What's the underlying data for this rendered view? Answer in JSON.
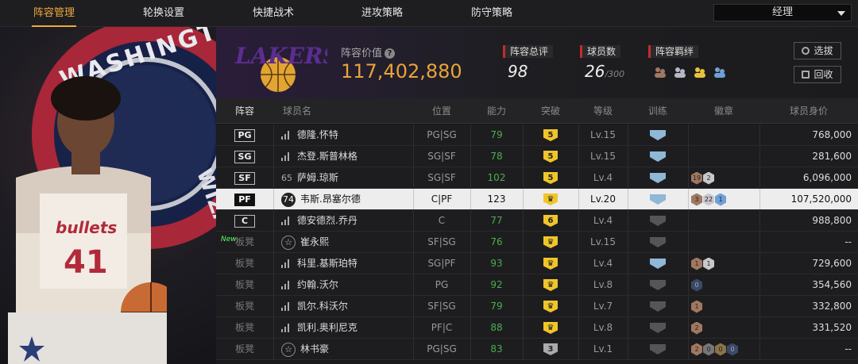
{
  "nav": {
    "tabs": [
      "阵容管理",
      "轮换设置",
      "快捷战术",
      "进攻策略",
      "防守策略"
    ],
    "active": 0,
    "manager_select": "经理"
  },
  "header": {
    "value_label": "阵容价值",
    "value": "117,402,880",
    "overall_label": "阵容总评",
    "overall": "98",
    "count_label": "球员数",
    "count": "26",
    "count_max": "/300",
    "bond_label": "阵容羁绊",
    "buttons": [
      "选拔",
      "回收"
    ]
  },
  "table": {
    "headers": [
      "阵容",
      "球员名",
      "位置",
      "能力",
      "突破",
      "等级",
      "训练",
      "徽章",
      "球员身价"
    ],
    "rows": [
      {
        "slot": "PG",
        "num": "",
        "name": "德隆.怀特",
        "position": "PG|SG",
        "ability": "79",
        "breakthrough": "5",
        "level": "Lv.15",
        "training": "blue",
        "badges": [],
        "value": "768,000",
        "green": true
      },
      {
        "slot": "SG",
        "num": "",
        "name": "杰登.斯普林格",
        "position": "SG|SF",
        "ability": "78",
        "breakthrough": "5",
        "level": "Lv.15",
        "training": "blue",
        "badges": [],
        "value": "281,600",
        "green": true
      },
      {
        "slot": "SF",
        "num": "65",
        "name": "萨姆.琼斯",
        "position": "SG|SF",
        "ability": "102",
        "breakthrough": "5",
        "level": "Lv.4",
        "training": "blue",
        "badges": [
          {
            "t": "19",
            "c": "br"
          },
          {
            "t": "2",
            "c": "sv"
          }
        ],
        "value": "6,096,000",
        "green": true
      },
      {
        "slot": "PF",
        "num": "74",
        "name": "韦斯.昂塞尔德",
        "position": "C|PF",
        "ability": "123",
        "breakthrough": "crown",
        "level": "Lv.20",
        "training": "blue",
        "badges": [
          {
            "t": "3",
            "c": "br"
          },
          {
            "t": "22",
            "c": "sv"
          },
          {
            "t": "1",
            "c": "bl"
          }
        ],
        "value": "107,520,000",
        "green": false
      },
      {
        "slot": "C",
        "num": "",
        "name": "德安德烈.乔丹",
        "position": "C",
        "ability": "77",
        "breakthrough": "6",
        "level": "Lv.4",
        "training": "dim",
        "badges": [],
        "value": "988,800",
        "green": true
      },
      {
        "slot": "板凳",
        "num": "",
        "name": "崔永熙",
        "position": "SF|SG",
        "ability": "76",
        "breakthrough": "crown",
        "level": "Lv.15",
        "training": "dim",
        "badges": [],
        "value": "--",
        "green": true
      },
      {
        "slot": "板凳",
        "num": "",
        "name": "科里.基斯珀特",
        "position": "SG|PF",
        "ability": "93",
        "breakthrough": "crown",
        "level": "Lv.4",
        "training": "blue",
        "badges": [
          {
            "t": "1",
            "c": "br"
          },
          {
            "t": "1",
            "c": "sv"
          }
        ],
        "value": "729,600",
        "green": true
      },
      {
        "slot": "板凳",
        "num": "",
        "name": "约翰.沃尔",
        "position": "PG",
        "ability": "92",
        "breakthrough": "crown",
        "level": "Lv.8",
        "training": "dim",
        "badges": [
          {
            "t": "0",
            "c": "dk"
          }
        ],
        "value": "354,560",
        "green": true
      },
      {
        "slot": "板凳",
        "num": "",
        "name": "凯尔.科沃尔",
        "position": "SF|SG",
        "ability": "79",
        "breakthrough": "crown",
        "level": "Lv.7",
        "training": "dim",
        "badges": [
          {
            "t": "1",
            "c": "br"
          }
        ],
        "value": "332,800",
        "green": true
      },
      {
        "slot": "板凳",
        "num": "",
        "name": "凯利.奥利尼克",
        "position": "PF|C",
        "ability": "88",
        "breakthrough": "crown",
        "level": "Lv.8",
        "training": "dim",
        "badges": [
          {
            "t": "2",
            "c": "br"
          }
        ],
        "value": "331,520",
        "green": true
      },
      {
        "slot": "板凳",
        "num": "",
        "name": "林书豪",
        "position": "PG|SG",
        "ability": "83",
        "breakthrough": "3",
        "level": "Lv.1",
        "training": "dim",
        "badges": [
          {
            "t": "2",
            "c": "br"
          },
          {
            "t": "0",
            "c": "gy"
          },
          {
            "t": "0",
            "c": "gd"
          },
          {
            "t": "0",
            "c": "dk"
          }
        ],
        "value": "--",
        "green": true
      }
    ]
  },
  "new_tag": "New",
  "art": {
    "team_text": "WASHINGTON",
    "team_text2": "WIZARDS",
    "jersey": "bullets",
    "jersey_num": "41",
    "team_logo": "LAKERS"
  },
  "colors": {
    "accent": "#f0a83a",
    "value": "#e9a43a",
    "green": "#4cae4c",
    "red": "#c52b2b"
  }
}
